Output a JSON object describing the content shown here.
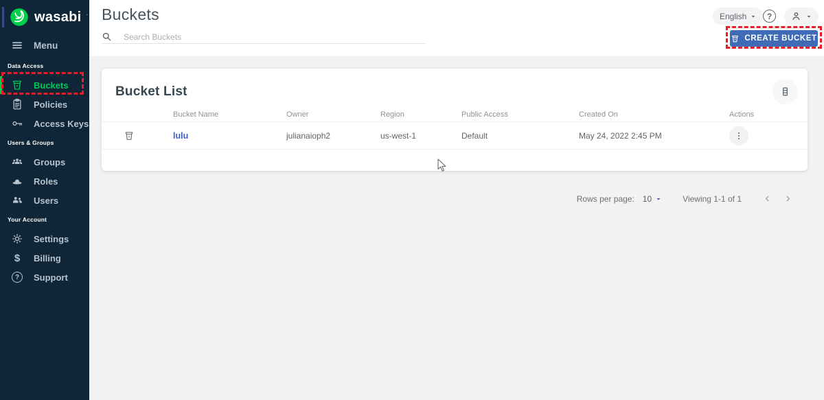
{
  "brand": {
    "name": "wasabi"
  },
  "sidebar": {
    "menu_label": "Menu",
    "sections": [
      {
        "label": "Data Access",
        "items": [
          {
            "label": "Buckets"
          },
          {
            "label": "Policies"
          },
          {
            "label": "Access Keys"
          }
        ]
      },
      {
        "label": "Users & Groups",
        "items": [
          {
            "label": "Groups"
          },
          {
            "label": "Roles"
          },
          {
            "label": "Users"
          }
        ]
      },
      {
        "label": "Your Account",
        "items": [
          {
            "label": "Settings"
          },
          {
            "label": "Billing"
          },
          {
            "label": "Support"
          }
        ]
      }
    ]
  },
  "header": {
    "title": "Buckets",
    "search_placeholder": "Search Buckets",
    "language_label": "English",
    "create_bucket_label": "CREATE BUCKET"
  },
  "bucket_list": {
    "title": "Bucket List",
    "columns": [
      "Bucket Name",
      "Owner",
      "Region",
      "Public Access",
      "Created On",
      "Actions"
    ],
    "rows": [
      {
        "name": "lulu",
        "owner": "julianaioph2",
        "region": "us-west-1",
        "public_access": "Default",
        "created_on": "May 24, 2022 2:45 PM"
      }
    ],
    "pagination": {
      "rows_per_page_label": "Rows per page:",
      "rows_per_page": "10",
      "viewing": "Viewing 1-1 of 1"
    }
  },
  "icons": {
    "billing_glyph": "$",
    "question_glyph": "?"
  },
  "colors": {
    "sidebar_bg": "#0e2638",
    "brand_green": "#00cf4b",
    "active_green": "#00c853",
    "button_blue": "#3f6ab5",
    "link_blue": "#3f5fc0",
    "highlight_red": "#ec1c24"
  }
}
